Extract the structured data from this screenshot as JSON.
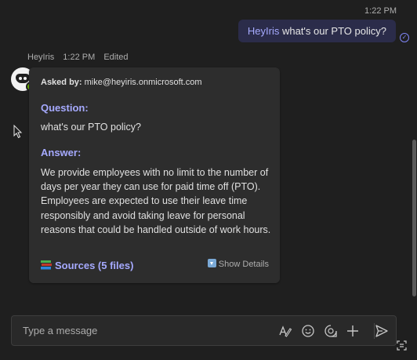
{
  "conversation": {
    "my_message": {
      "time": "1:22 PM",
      "mention": "HeyIris",
      "text": " what's our PTO policy?"
    },
    "bot_message": {
      "sender": "HeyIris",
      "time": "1:22 PM",
      "edited": "Edited",
      "card": {
        "asked_by_label": "Asked by:",
        "asked_by_value": " mike@heyiris.onmicrosoft.com",
        "question_label": "Question:",
        "question": "what's our PTO policy?",
        "answer_label": "Answer:",
        "answer": "We provide employees with no limit to the number of days per year they can use for paid time off (PTO). Employees are expected to use their leave time responsibly and avoid taking leave for personal reasons that could be handled outside of work hours.",
        "sources_label": "Sources (5 files)",
        "show_details_label": "Show Details"
      }
    }
  },
  "composer": {
    "placeholder": "Type a message"
  },
  "colors": {
    "background": "#1f1f1f",
    "card": "#2d2d2d",
    "accent": "#a6aaff",
    "my_bubble": "#2b2c4a",
    "presence_available": "#6bb700"
  },
  "icons": [
    "read-receipt-icon",
    "bot-avatar-icon",
    "books-icon",
    "show-details-icon",
    "mouse-cursor-icon",
    "format-icon",
    "emoji-icon",
    "loop-icon",
    "plus-icon",
    "send-icon",
    "screen-capture-icon"
  ]
}
